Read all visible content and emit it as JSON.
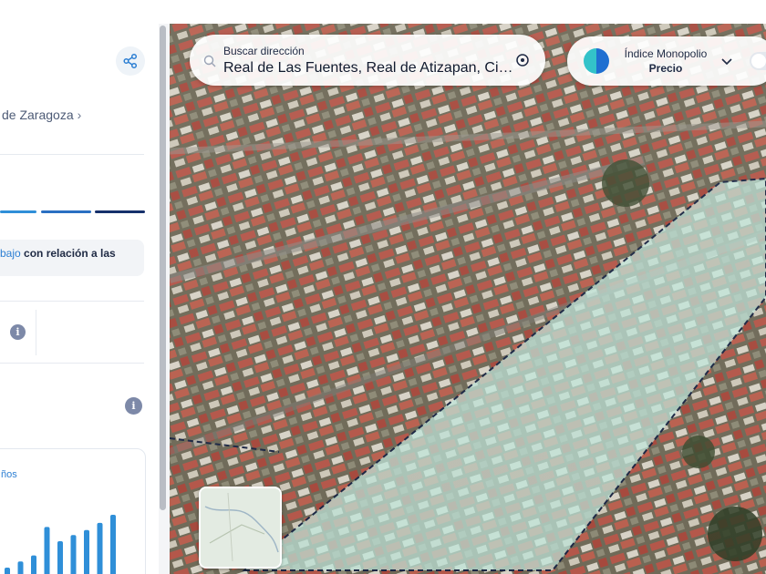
{
  "panel": {
    "breadcrumb": "de Zaragoza",
    "breadcrumb_chevron": "›",
    "note_highlight": "bajo",
    "note_text": " con relación a las",
    "chart_label": "ños",
    "segment_colors": [
      "#2f8fd8",
      "#2a6fc2",
      "#16306b"
    ]
  },
  "map": {
    "search": {
      "label": "Buscar dirección",
      "value": "Real de Las Fuentes, Real de Atizapan, Ciu…"
    },
    "index": {
      "title": "Índice Monopolio",
      "subtitle": "Precio"
    }
  },
  "icons": [
    "share-icon",
    "info-icon",
    "search-icon",
    "locate-icon",
    "chevron-down-icon"
  ],
  "chart_data": {
    "type": "bar",
    "values": [
      18,
      24,
      30,
      58,
      44,
      50,
      55,
      62,
      70
    ],
    "color": "#2f8fd8"
  }
}
